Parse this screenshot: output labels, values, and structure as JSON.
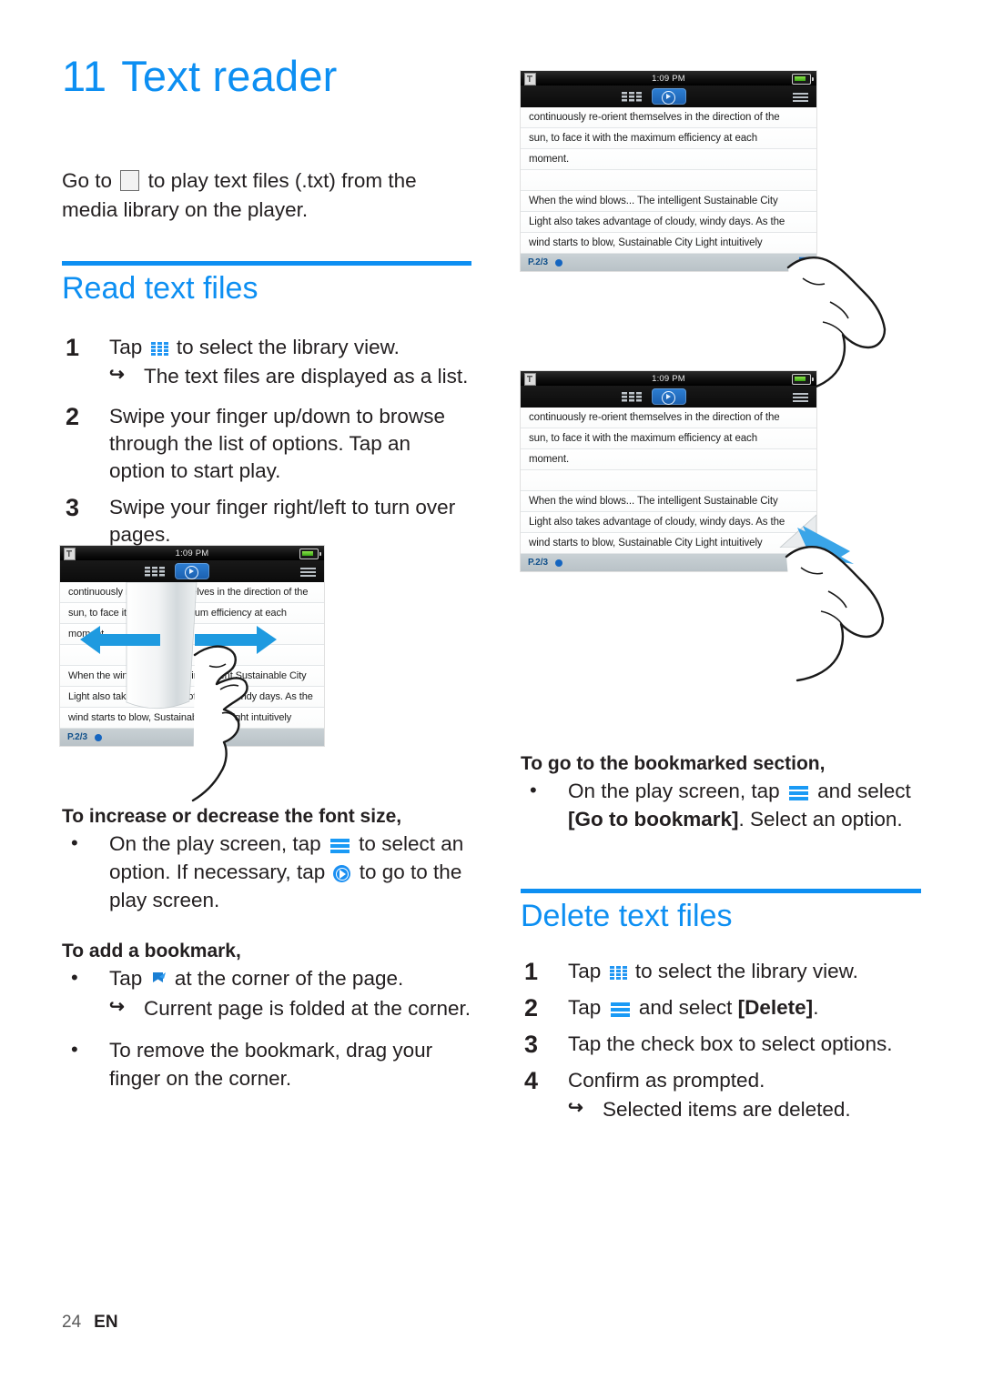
{
  "document": {
    "chapter_number": "11",
    "chapter_title": "Text reader",
    "intro_part1": "Go to",
    "intro_part2": "to play text files (.txt) from the media library on the player.",
    "folio_page": "24",
    "folio_lang": "EN",
    "accent_color": "#0d8ff2",
    "text_color": "#231f20"
  },
  "sections": {
    "read": {
      "title": "Read text files",
      "steps": [
        {
          "num": "1",
          "pre": "Tap",
          "icon": "library-grid-icon",
          "post": "to select the library view.",
          "result": "The text files are displayed as a list."
        },
        {
          "num": "2",
          "pre": "Swipe your finger up/down to browse through the list of options. Tap an option to start play.",
          "icon": "",
          "post": "",
          "result": ""
        },
        {
          "num": "3",
          "pre": "Swipe your finger right/left to turn over pages.",
          "icon": "",
          "post": "",
          "result": ""
        }
      ],
      "font_size_subhead": "To increase or decrease the font size,",
      "font_size_bullet_a": "On the play screen, tap",
      "font_size_bullet_b": "to select an option. If necessary, tap",
      "font_size_bullet_c": "to go to the play screen.",
      "bookmark_subhead": "To add a bookmark,",
      "bookmark_bullet_a": "Tap",
      "bookmark_bullet_b": "at the corner of the page.",
      "bookmark_result": "Current page is folded at the corner.",
      "bookmark_remove": "To remove the bookmark, drag your finger on the corner."
    },
    "goto_bookmark": {
      "subhead": "To go to the bookmarked section,",
      "bullet_a": "On the play screen, tap",
      "bullet_b": "and select",
      "bullet_bold": "[Go to bookmark]",
      "bullet_c": ". Select an option."
    },
    "delete": {
      "title": "Delete text files",
      "steps": [
        {
          "num": "1",
          "pre": "Tap",
          "icon": "library-grid-icon",
          "post": "to select the library view.",
          "bold": "",
          "tail": ""
        },
        {
          "num": "2",
          "pre": "Tap",
          "icon": "menu-icon",
          "post": "and select",
          "bold": "[Delete]",
          "tail": "."
        },
        {
          "num": "3",
          "pre": "Tap the check box to select options.",
          "icon": "",
          "post": "",
          "bold": "",
          "tail": ""
        },
        {
          "num": "4",
          "pre": "Confirm as prompted.",
          "icon": "",
          "post": "",
          "bold": "",
          "tail": ""
        }
      ],
      "result": "Selected items are deleted."
    }
  },
  "device_screens": {
    "status_time": "1:09 PM",
    "page_indicator": "P.2/3",
    "text_lines": [
      "continuously re-orient themselves in the direction of the",
      "sun, to face it with the maximum efficiency at each",
      "moment.",
      "",
      "When the wind blows... The intelligent Sustainable City",
      "Light also takes advantage of cloudy, windy days. As the",
      "wind starts to blow, Sustainable City Light intuitively"
    ],
    "obscured_text_lines": [
      "continuously re",
      "sun, to face it v",
      "moment.",
      "",
      "When the wl",
      "Light also t",
      "wind start"
    ],
    "obscured_text_right": [
      "e direction of the",
      "iency at each",
      "",
      "",
      "nt Sustainable City",
      "days. As the",
      "itively"
    ]
  }
}
